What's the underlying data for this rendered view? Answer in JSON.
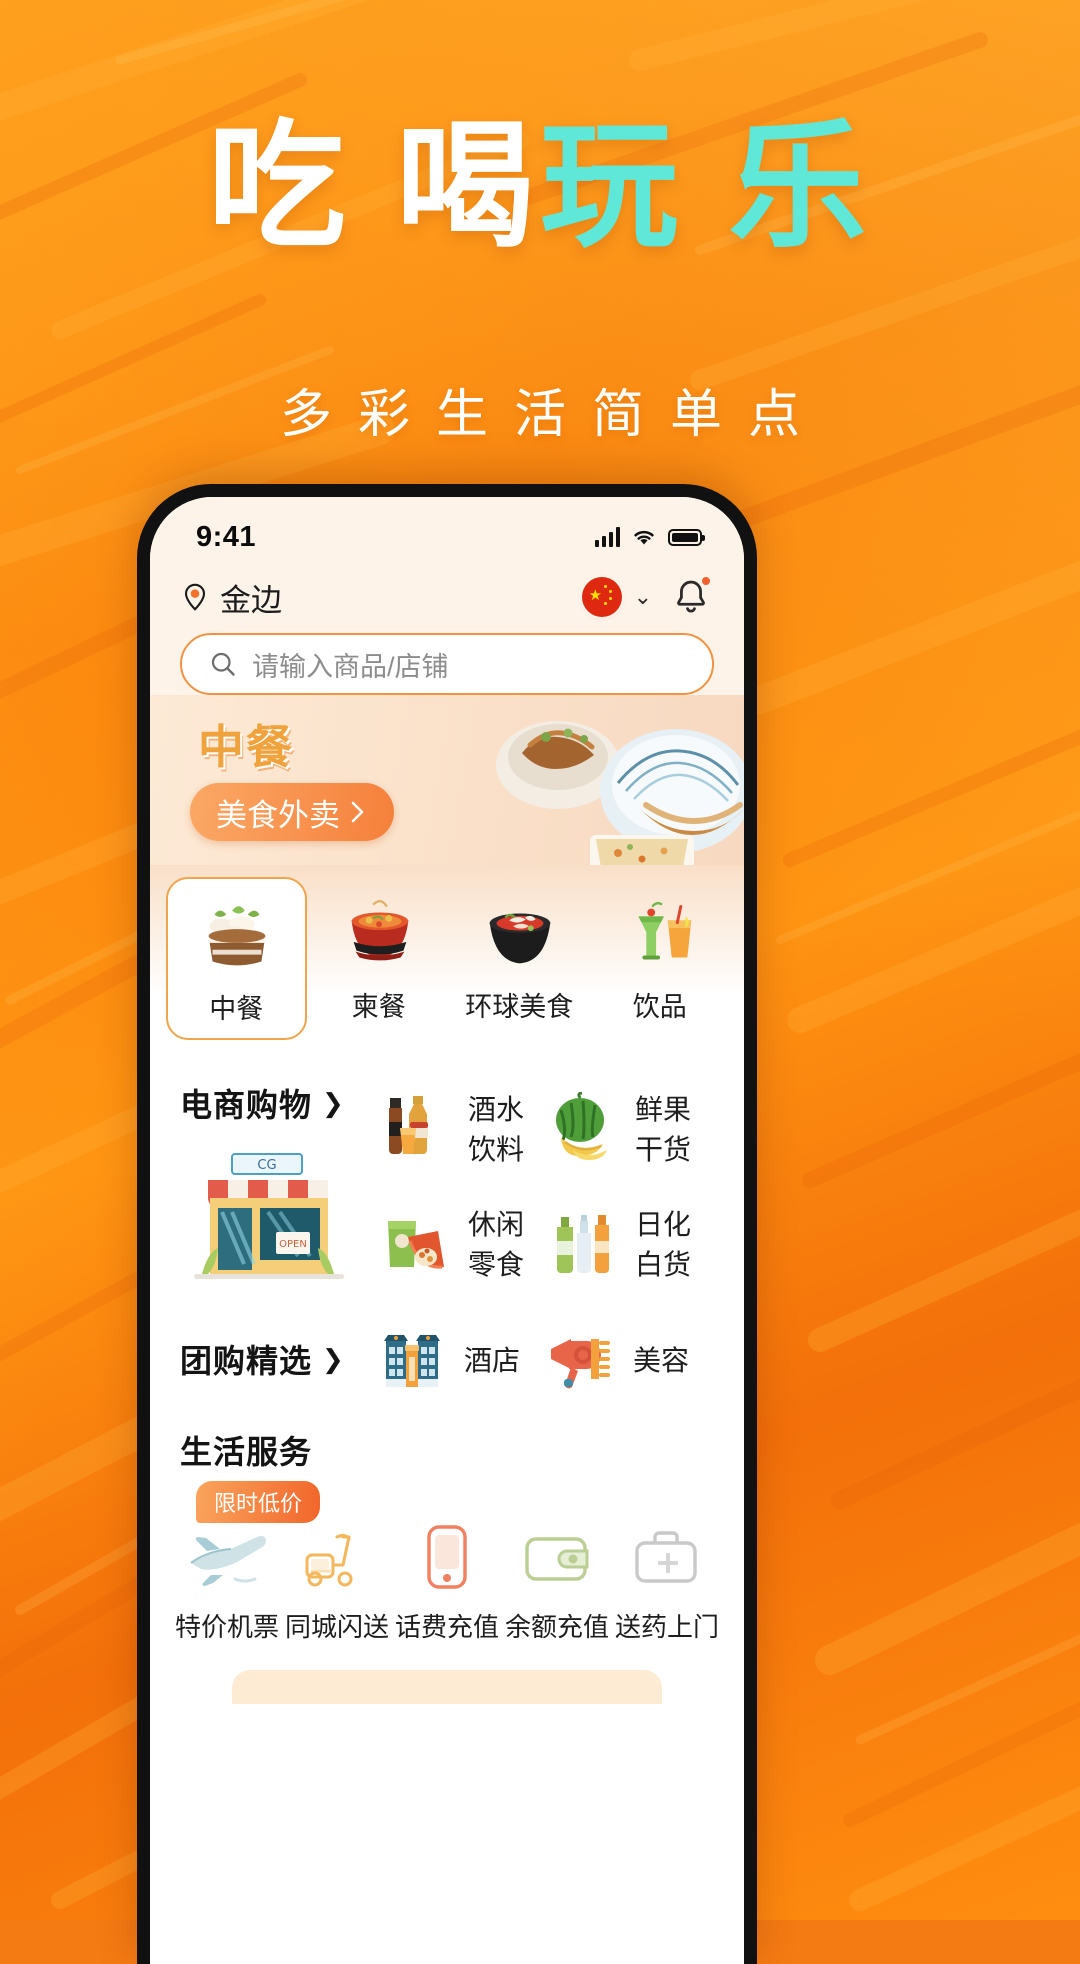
{
  "poster": {
    "headline_white": "吃 喝",
    "headline_cyan": "玩 乐",
    "subtitle": "多彩生活简单点",
    "colors": {
      "bg_orange": "#F97B06",
      "headline_white": "#FFFFFF",
      "headline_cyan": "#5FE8D8",
      "accent": "#F5803B"
    }
  },
  "status_bar": {
    "time": "9:41",
    "signal_icon": "cellular-signal-icon",
    "wifi_icon": "wifi-icon",
    "battery_icon": "battery-icon"
  },
  "header": {
    "location_icon": "location-pin-icon",
    "location": "金边",
    "flag_icon": "china-flag-icon",
    "chevron_icon": "chevron-down-icon",
    "bell_icon": "notification-bell-icon",
    "has_notification": true
  },
  "search": {
    "icon": "search-icon",
    "placeholder": "请输入商品/店铺",
    "value": ""
  },
  "banner": {
    "title": "中餐",
    "button_label": "美食外卖",
    "button_arrow": "chevron-right-icon",
    "image_icon": "noodle-bowl-photo"
  },
  "categories": [
    {
      "label": "中餐",
      "icon": "steamer-dumplings-icon",
      "active": true
    },
    {
      "label": "柬餐",
      "icon": "red-bowl-soup-icon",
      "active": false
    },
    {
      "label": "环球美食",
      "icon": "black-bowl-ramen-icon",
      "active": false
    },
    {
      "label": "饮品",
      "icon": "cocktail-drinks-icon",
      "active": false
    }
  ],
  "ecommerce": {
    "title": "电商购物",
    "arrow": "chevron-right-icon",
    "hero_icon": "storefront-illustration",
    "items": [
      {
        "label": "酒水饮料",
        "icon": "liquor-bottles-icon"
      },
      {
        "label": "鲜果干货",
        "icon": "watermelon-banana-icon"
      },
      {
        "label": "休闲零食",
        "icon": "snack-bags-icon"
      },
      {
        "label": "日化白货",
        "icon": "toiletries-bottles-icon"
      }
    ]
  },
  "groupbuy": {
    "title": "团购精选",
    "arrow": "chevron-right-icon",
    "items": [
      {
        "label": "酒店",
        "icon": "hotel-building-icon"
      },
      {
        "label": "美容",
        "icon": "hairdryer-comb-icon"
      }
    ]
  },
  "life_services": {
    "title": "生活服务",
    "badge": "限时低价",
    "items": [
      {
        "label": "特价机票",
        "icon": "airplane-icon"
      },
      {
        "label": "同城闪送",
        "icon": "scooter-icon"
      },
      {
        "label": "话费充值",
        "icon": "mobile-phone-icon"
      },
      {
        "label": "余额充值",
        "icon": "wallet-icon"
      },
      {
        "label": "送药上门",
        "icon": "medical-kit-icon"
      }
    ]
  }
}
